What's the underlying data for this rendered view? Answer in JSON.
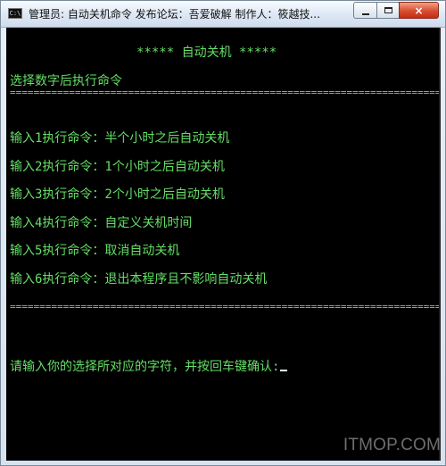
{
  "window": {
    "title": "管理员: 自动关机命令 发布论坛：吾爱破解 制作人：筱越技...",
    "icon": "console-icon"
  },
  "controls": {
    "minimize_icon": "minimize-icon",
    "maximize_icon": "maximize-icon",
    "close_label": "×"
  },
  "console": {
    "header": "***** 自动关机 *****",
    "subtitle": "选择数字后执行命令",
    "separator": "==========================================================================================",
    "options": [
      "输入1执行命令：半个小时之后自动关机",
      "输入2执行命令：1个小时之后自动关机",
      "输入3执行命令：2个小时之后自动关机",
      "输入4执行命令：自定义关机时间",
      "输入5执行命令：取消自动关机",
      "输入6执行命令：退出本程序且不影响自动关机"
    ],
    "prompt": "请输入你的选择所对应的字符，并按回车键确认:"
  },
  "watermark": "ITMOP.COM",
  "colors": {
    "console_background": "#000000",
    "console_text": "#65df66",
    "cursor": "#ffffff",
    "close_button": "#d84d31"
  }
}
